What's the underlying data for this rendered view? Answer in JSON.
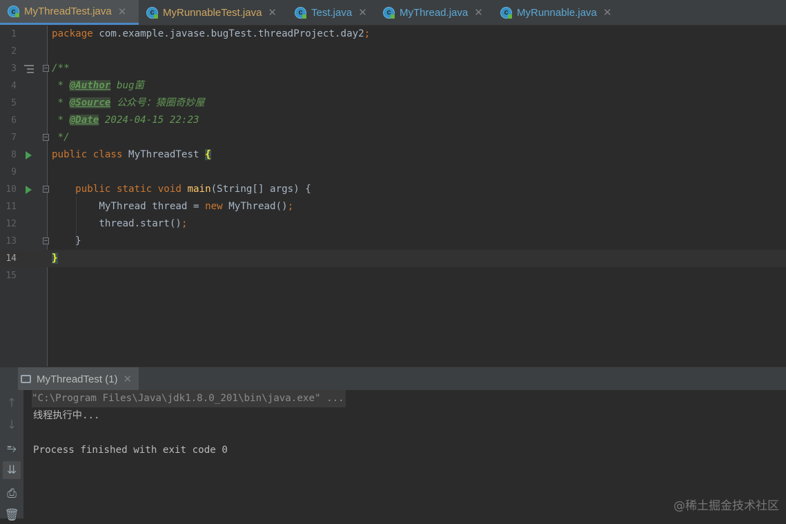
{
  "tabs": [
    {
      "label": "MyThreadTest.java",
      "active": true
    },
    {
      "label": "MyRunnableTest.java",
      "active": false
    },
    {
      "label": "Test.java",
      "active": false
    },
    {
      "label": "MyThread.java",
      "active": false
    },
    {
      "label": "MyRunnable.java",
      "active": false
    }
  ],
  "editor": {
    "line_numbers": [
      "1",
      "2",
      "3",
      "4",
      "5",
      "6",
      "7",
      "8",
      "9",
      "10",
      "11",
      "12",
      "13",
      "14",
      "15"
    ],
    "current_line": "14",
    "code": {
      "l1_kw": "package",
      "l1_rest": " com.example.javase.bugTest.threadProject.day2",
      "l1_semi": ";",
      "l3": "/**",
      "l4_star": " * ",
      "l4_tag": "@Author",
      "l4_val": " bug菌",
      "l5_star": " * ",
      "l5_tag": "@Source",
      "l5_val": " 公众号：猿圈奇妙屋",
      "l6_star": " * ",
      "l6_tag": "@Date",
      "l6_val": " 2024-04-15 22:23",
      "l7": " */",
      "l8_kw": "public class",
      "l8_name": " MyThreadTest ",
      "l8_brace": "{",
      "l10_indent": "    ",
      "l10_kw": "public static void",
      "l10_fn": "main",
      "l10_rest": "(String[] args) {",
      "l11_indent": "        ",
      "l11_a": "MyThread thread = ",
      "l11_kw": "new",
      "l11_b": " MyThread()",
      "l11_semi": ";",
      "l12_indent": "        ",
      "l12_a": "thread.start()",
      "l12_semi": ";",
      "l13": "    }",
      "l14_brace": "}"
    }
  },
  "run_panel": {
    "tab_label": "MyThreadTest (1)",
    "console_lines": [
      "\"C:\\Program Files\\Java\\jdk1.8.0_201\\bin\\java.exe\" ...",
      "线程执行中...",
      "",
      "Process finished with exit code 0"
    ],
    "tools": [
      "up-arrow-icon",
      "down-arrow-icon",
      "soft-wrap-icon",
      "scroll-to-end-icon",
      "print-icon",
      "trash-icon"
    ]
  },
  "watermark": "@稀土掘金技术社区",
  "colors": {
    "keyword": "#cc7832",
    "comment": "#629755",
    "function": "#ffc66d",
    "text": "#a9b7c6",
    "background": "#2b2b2b",
    "tab_accent": "#4a88c7"
  }
}
